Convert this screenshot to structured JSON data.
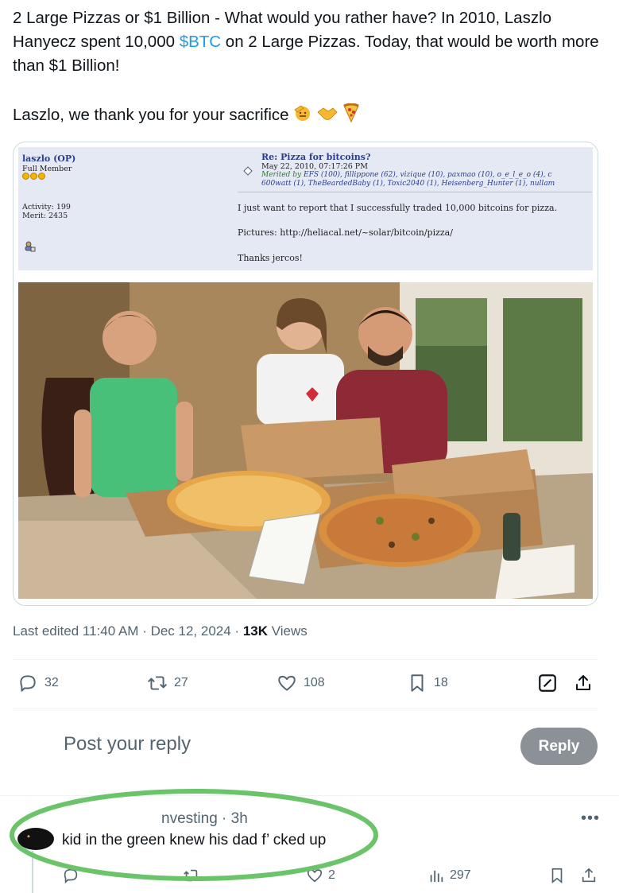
{
  "tweet": {
    "line1_a": "2 Large Pizzas or $1 Billion - What would you rather have?  In 2010, Laszlo Hanyecz spent 10,000 ",
    "cashtag": "$BTC",
    "line1_b": " on 2 Large Pizzas.  Today, that would be worth more than $1 Billion!",
    "line2": "Laszlo, we thank you for your sacrifice"
  },
  "forum": {
    "username": "laszlo (OP)",
    "rank": "Full Member",
    "activity": "Activity: 199",
    "merit": "Merit: 2435",
    "subject": "Re: Pizza for bitcoins?",
    "date": "May 22, 2010, 07:17:26 PM",
    "merited_label": "Merited by",
    "merited_1": "EFS (100), fillippone (62), vizique (10), paxmao (10), o_e_l_e_o (4), c",
    "merited_2": "600watt (1), TheBeardedBaby (1), Toxic2040 (1), Heisenberg_Hunter (1), nullam",
    "body_1": "I just want to report that I successfully traded 10,000 bitcoins for pizza.",
    "body_2": "Pictures: http://heliacal.net/~solar/bitcoin/pizza/",
    "body_3": "Thanks jercos!"
  },
  "meta": {
    "edited": "Last edited 11:40 AM · Dec 12, 2024 · ",
    "views_count": "13K",
    "views_label": " Views"
  },
  "actions": {
    "replies": "32",
    "reposts": "27",
    "likes": "108",
    "bookmarks": "18"
  },
  "compose": {
    "placeholder": "Post your reply",
    "button": "Reply"
  },
  "reply": {
    "header": "nvesting · 3h",
    "text": "kid in the green knew his dad f’ cked up",
    "likes": "2",
    "views": "297"
  },
  "colors": {
    "accent": "#1d9bf0",
    "circle": "#6cc46a"
  }
}
